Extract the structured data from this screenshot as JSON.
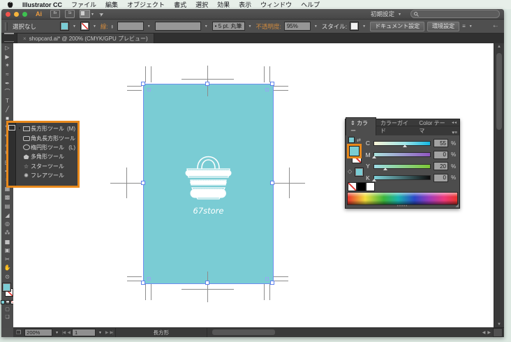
{
  "menubar": {
    "items": [
      "Illustrator CC",
      "ファイル",
      "編集",
      "オブジェクト",
      "書式",
      "選択",
      "効果",
      "表示",
      "ウィンドウ",
      "ヘルプ"
    ]
  },
  "appbar": {
    "bridge_label": "Br",
    "stock_label": "St",
    "workspace": "初期設定"
  },
  "controlbar": {
    "selection_status": "選択なし",
    "stroke_label": "線:",
    "brush_label": "5 pt. 丸筆",
    "opacity_label": "不透明度:",
    "opacity_value": "95%",
    "style_label": "スタイル:",
    "document_setup": "ドキュメント設定",
    "preferences": "環境設定"
  },
  "doc_tab": {
    "close": "×",
    "title": "shopcard.ai* @ 200% (CMYK/GPU プレビュー)"
  },
  "toolbar": {
    "tools": [
      {
        "name": "selection-tool",
        "glyph": "▷"
      },
      {
        "name": "direct-selection-tool",
        "glyph": "▶"
      },
      {
        "name": "magic-wand-tool",
        "glyph": "✶"
      },
      {
        "name": "lasso-tool",
        "glyph": "≈"
      },
      {
        "name": "pen-tool",
        "glyph": "✒"
      },
      {
        "name": "curvature-tool",
        "glyph": "⌒"
      },
      {
        "name": "type-tool",
        "glyph": "T"
      },
      {
        "name": "line-tool",
        "glyph": "╱"
      },
      {
        "name": "rectangle-tool",
        "glyph": "■",
        "active": true
      },
      {
        "name": "paintbrush-tool",
        "glyph": "✎"
      },
      {
        "name": "pencil-tool",
        "glyph": "✏"
      },
      {
        "name": "eraser-tool",
        "glyph": "▱"
      },
      {
        "name": "rotate-tool",
        "glyph": "↻"
      },
      {
        "name": "scale-tool",
        "glyph": "◱"
      },
      {
        "name": "width-tool",
        "glyph": "✚"
      },
      {
        "name": "free-transform-tool",
        "glyph": "⌗"
      },
      {
        "name": "perspective-grid-tool",
        "glyph": "▦"
      },
      {
        "name": "mesh-tool",
        "glyph": "▩"
      },
      {
        "name": "gradient-tool",
        "glyph": "▤"
      },
      {
        "name": "eyedropper-tool",
        "glyph": "◢"
      },
      {
        "name": "blend-tool",
        "glyph": "◎"
      },
      {
        "name": "symbol-sprayer-tool",
        "glyph": "⁂"
      },
      {
        "name": "column-graph-tool",
        "glyph": "▅"
      },
      {
        "name": "artboard-tool",
        "glyph": "▣"
      },
      {
        "name": "slice-tool",
        "glyph": "✂"
      },
      {
        "name": "hand-tool",
        "glyph": "✋"
      },
      {
        "name": "zoom-tool",
        "glyph": "⊙"
      }
    ]
  },
  "flyout": {
    "items": [
      {
        "label": "長方形ツール",
        "shortcut": "(M)",
        "active": true
      },
      {
        "label": "角丸長方形ツール",
        "shortcut": ""
      },
      {
        "label": "楕円形ツール",
        "shortcut": "(L)"
      },
      {
        "label": "多角形ツール",
        "shortcut": ""
      },
      {
        "label": "スターツール",
        "shortcut": ""
      },
      {
        "label": "フレアツール",
        "shortcut": ""
      }
    ]
  },
  "canvas": {
    "artboard_text": "67store"
  },
  "color_panel": {
    "tabs": [
      "カラー",
      "カラーガイド",
      "Color テーマ"
    ],
    "channels": [
      {
        "label": "C",
        "value": 55
      },
      {
        "label": "M",
        "value": 0
      },
      {
        "label": "Y",
        "value": 20
      },
      {
        "label": "K",
        "value": 0
      }
    ],
    "unit": "%"
  },
  "statusbar": {
    "zoom": "200%",
    "artboard_number": "1",
    "current_tool": "長方形"
  },
  "colors": {
    "artboard_teal": "#7accd4",
    "highlight_orange": "#e8891c",
    "selection_blue": "#6f8ef0",
    "none_red": "#e0332e"
  }
}
